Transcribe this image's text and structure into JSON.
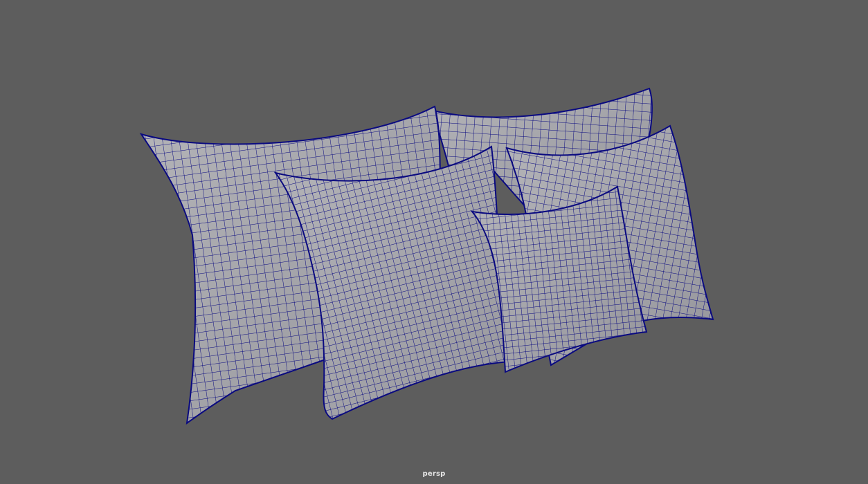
{
  "viewport": {
    "camera_name": "persp",
    "background_color": "#5d5d5d",
    "mesh_fill_color": "#a8a8ac",
    "mesh_shade_color": "#8e8e94",
    "wireframe_color": "#0a0a80",
    "display_mode": "wireframe-on-shaded"
  },
  "objects": [
    {
      "name": "pillow-back-left",
      "type": "pillow-mesh"
    },
    {
      "name": "pillow-back-right",
      "type": "pillow-mesh"
    },
    {
      "name": "pillow-front-left",
      "type": "pillow-mesh"
    },
    {
      "name": "pillow-mid-right",
      "type": "pillow-mesh"
    },
    {
      "name": "pillow-front-small",
      "type": "pillow-mesh"
    }
  ]
}
